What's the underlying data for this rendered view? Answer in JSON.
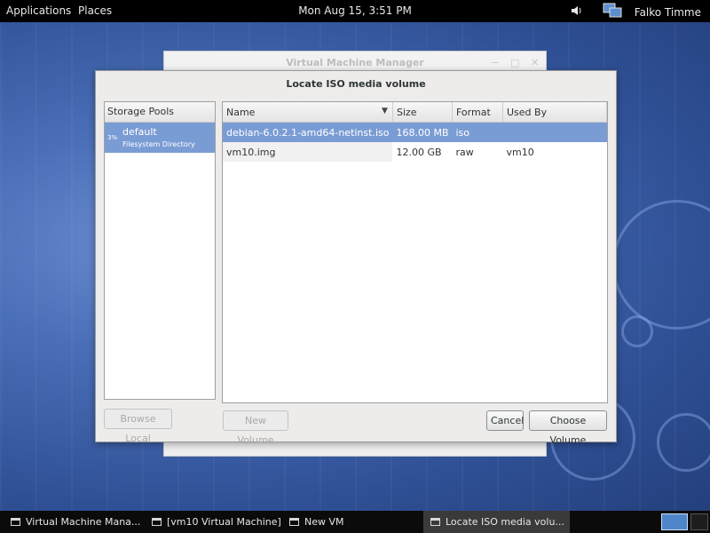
{
  "top_panel": {
    "applications": "Applications",
    "places": "Places",
    "clock": "Mon Aug 15,  3:51 PM",
    "user": "Falko Timme",
    "icons": [
      "volume-icon",
      "network-icon"
    ]
  },
  "bg_window": {
    "title": "Virtual Machine Manager",
    "controls": [
      "minimize-icon",
      "maximize-icon",
      "close-icon"
    ]
  },
  "dialog": {
    "title": "Locate ISO media volume",
    "pools_header": "Storage Pools",
    "pools": [
      {
        "percent": "3%",
        "name": "default",
        "type": "Filesystem Directory"
      }
    ],
    "columns": [
      "Name",
      "Size",
      "Format",
      "Used By"
    ],
    "volumes": [
      {
        "name": "debian-6.0.2.1-amd64-netinst.iso",
        "size": "168.00 MB",
        "format": "iso",
        "used_by": ""
      },
      {
        "name": "vm10.img",
        "size": "12.00 GB",
        "format": "raw",
        "used_by": "vm10"
      }
    ],
    "buttons": {
      "browse_local": "Browse Local",
      "new_volume": "New Volume",
      "cancel": "Cancel",
      "choose_volume": "Choose Volume"
    }
  },
  "taskbar": {
    "tasks": [
      "Virtual Machine Mana...",
      "[vm10 Virtual Machine]",
      "New VM",
      "Locate ISO media volu..."
    ]
  }
}
